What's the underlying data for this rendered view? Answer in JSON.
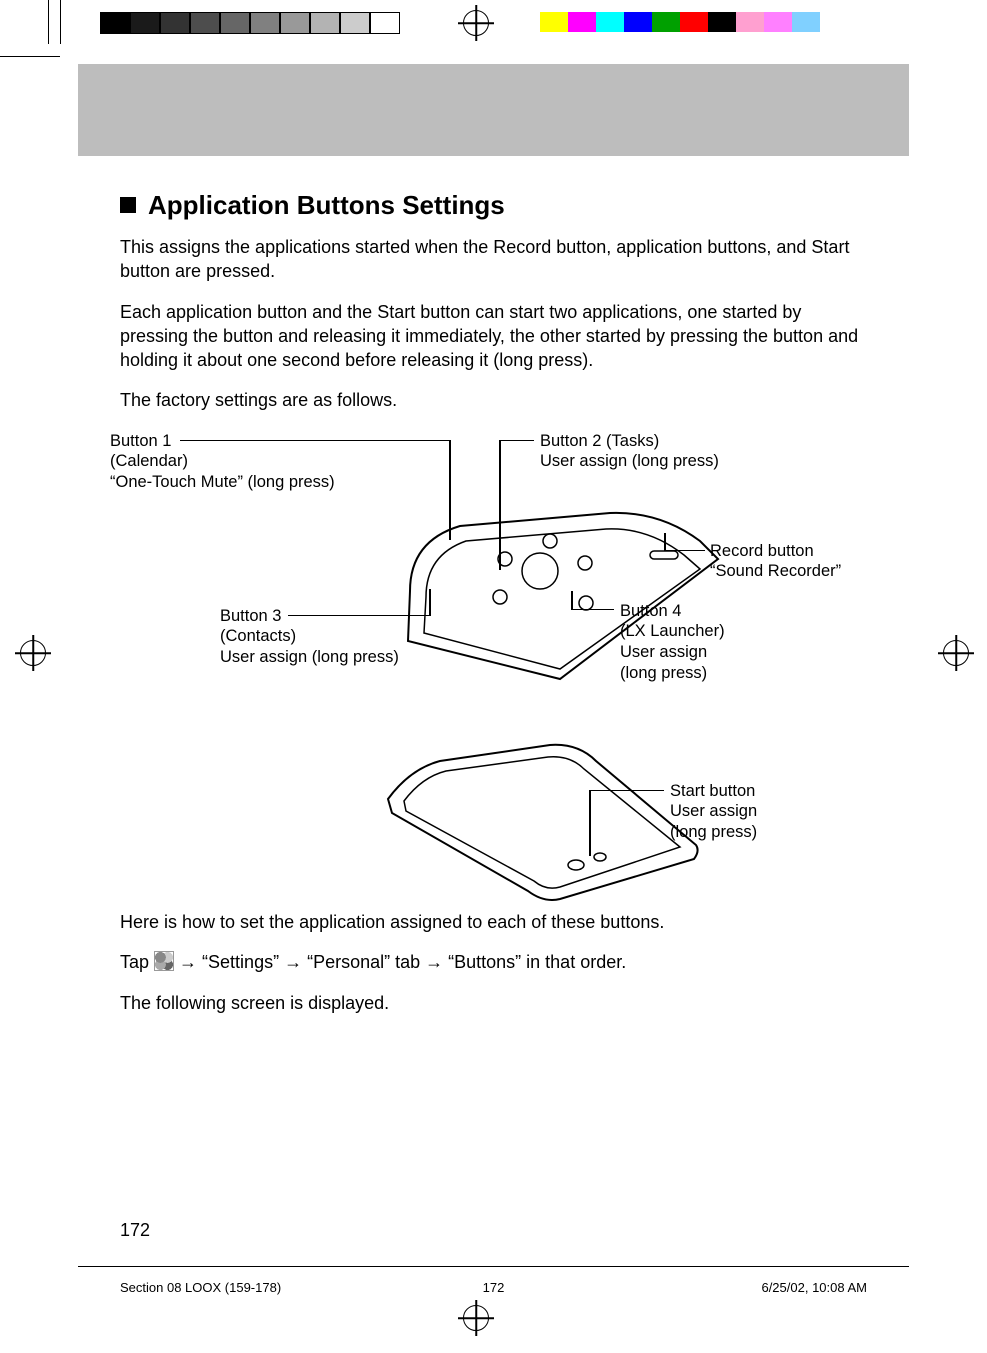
{
  "heading": "Application Buttons Settings",
  "para1": "This assigns the applications started when the Record button, application buttons, and Start button are pressed.",
  "para2": "Each application button and the Start button can start two applications, one started by pressing the button and releasing it immediately, the other started by pressing the button and holding it about one second before releasing it (long press).",
  "para3": "The factory settings are as follows.",
  "callouts": {
    "button1": {
      "l1": "Button 1",
      "l2": "(Calendar)",
      "l3": "“One-Touch Mute” (long press)"
    },
    "button2": {
      "l1": "Button 2 (Tasks)",
      "l2": "User assign (long press)"
    },
    "record": {
      "l1": "Record button",
      "l2": "“Sound Recorder”"
    },
    "button3": {
      "l1": "Button 3",
      "l2": "(Contacts)",
      "l3": "User assign (long press)"
    },
    "button4": {
      "l1": "Button 4",
      "l2": "(LX Launcher)",
      "l3": "User assign",
      "l4": "(long press)"
    },
    "start": {
      "l1": "Start button",
      "l2": "User assign",
      "l3": "(long press)"
    }
  },
  "lower": {
    "l1": "Here is how to set the application assigned to each of these buttons.",
    "l2_prefix": "Tap ",
    "l2_suffix": " → “Settings” → “Personal” tab → “Buttons” in that order.",
    "l3": "The following screen is displayed."
  },
  "page_number": "172",
  "footer": {
    "left": "Section 08 LOOX (159-178)",
    "center": "172",
    "right": "6/25/02, 10:08 AM"
  },
  "colorbar_top_gray": [
    "#000000",
    "#1a1a1a",
    "#333333",
    "#4d4d4d",
    "#666666",
    "#808080",
    "#999999",
    "#b3b3b3",
    "#cccccc",
    "#ffffff"
  ],
  "colorbar_top_color": [
    "#ffff00",
    "#ff00ff",
    "#00ffff",
    "#0000ff",
    "#00a000",
    "#ff0000",
    "#000000",
    "#ffa0d0",
    "#ff80ff",
    "#80d0ff"
  ]
}
